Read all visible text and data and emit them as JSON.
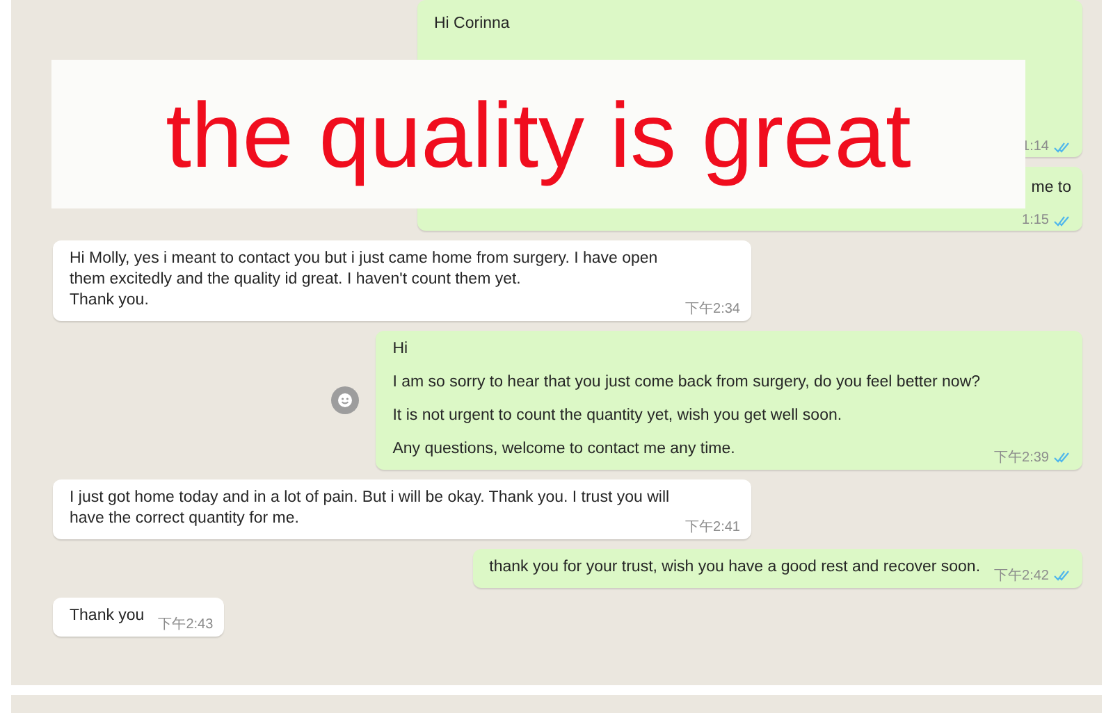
{
  "caption": {
    "text": "the quality is great"
  },
  "messages": [
    {
      "kind": "out",
      "paragraphs": [
        "Hi Corinna"
      ],
      "time": "1:14",
      "read": true,
      "covered": true
    },
    {
      "kind": "out",
      "paragraphs": [
        "me to"
      ],
      "time": "1:15",
      "read": true,
      "covered": true
    },
    {
      "kind": "in",
      "paragraphs": [
        "Hi Molly, yes i meant to contact you but i just came home from surgery. I have open them excitedly and the quality id great. I haven't count them yet.\nThank you."
      ],
      "time": "下午2:34"
    },
    {
      "kind": "out",
      "paragraphs": [
        "Hi",
        "I am so sorry to hear that you just come back from surgery, do you feel better now?",
        "It is not urgent to count the quantity yet, wish you get well soon.",
        "Any questions, welcome to contact me any time."
      ],
      "time": "下午2:39",
      "read": true,
      "emoji_button": true
    },
    {
      "kind": "in",
      "paragraphs": [
        "I just got home today and in a lot of pain. But i will be okay. Thank you. I trust you will have the correct quantity for me."
      ],
      "time": "下午2:41"
    },
    {
      "kind": "out",
      "paragraphs": [
        "thank you for your trust, wish you have a good rest and recover soon."
      ],
      "time": "下午2:42",
      "read": true
    },
    {
      "kind": "in",
      "paragraphs": [
        "Thank you"
      ],
      "time": "下午2:43"
    }
  ]
}
